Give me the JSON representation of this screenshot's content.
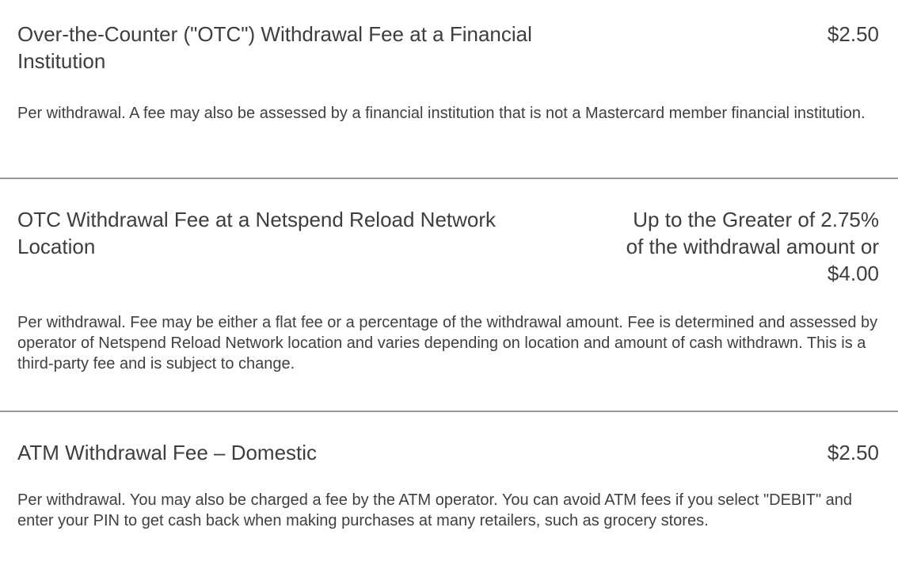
{
  "fees": [
    {
      "title": "Over-the-Counter (\"OTC\") Withdrawal Fee at a Financial Institution",
      "amount": "$2.50",
      "description": "Per withdrawal. A fee may also be assessed by a financial institution that is not a Mastercard member financial institution."
    },
    {
      "title": "OTC Withdrawal Fee at a Netspend Reload Network Location",
      "amount": "Up to the Greater of 2.75% of the withdrawal amount or $4.00",
      "description": "Per withdrawal. Fee may be either a flat fee or a percentage of the withdrawal amount. Fee is determined and assessed by operator of Netspend Reload Network location and varies depending on location and amount of cash withdrawn. This is a third-party fee and is subject to change."
    },
    {
      "title": "ATM Withdrawal Fee – Domestic",
      "amount": "$2.50",
      "description": "Per withdrawal. You may also be charged a fee by the ATM operator. You can avoid ATM fees if you select \"DEBIT\" and enter your PIN to get cash back when making purchases at many retailers, such as grocery stores."
    }
  ]
}
